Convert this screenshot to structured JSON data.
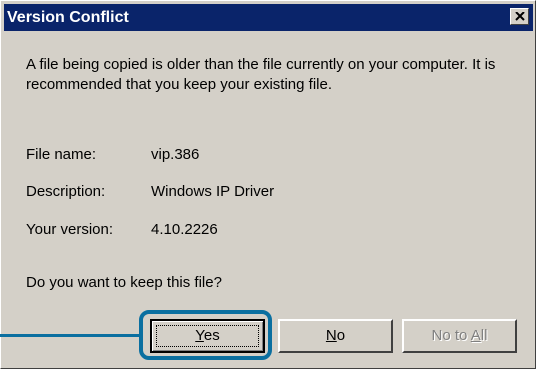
{
  "window": {
    "title": "Version Conflict",
    "close_icon": "close-icon"
  },
  "message": "A file being copied is older than the file currently on your computer. It is recommended that you keep your existing file.",
  "fields": [
    {
      "label": "File name:",
      "value": "vip.386"
    },
    {
      "label": "Description:",
      "value": "Windows IP Driver"
    },
    {
      "label": "Your version:",
      "value": "4.10.2226"
    }
  ],
  "question": "Do you want to keep this file?",
  "buttons": {
    "yes": {
      "label": "Yes",
      "mnemonic": "Y",
      "rest": "es"
    },
    "no": {
      "label": "No",
      "mnemonic": "N",
      "rest": "o"
    },
    "no_to_all": {
      "label": "No to All",
      "prefix": "No to ",
      "mnemonic": "A",
      "rest": "ll"
    }
  },
  "colors": {
    "titlebar": "#0a246a",
    "dialog_face": "#d4d0c8",
    "callout": "#0a6fa0"
  }
}
